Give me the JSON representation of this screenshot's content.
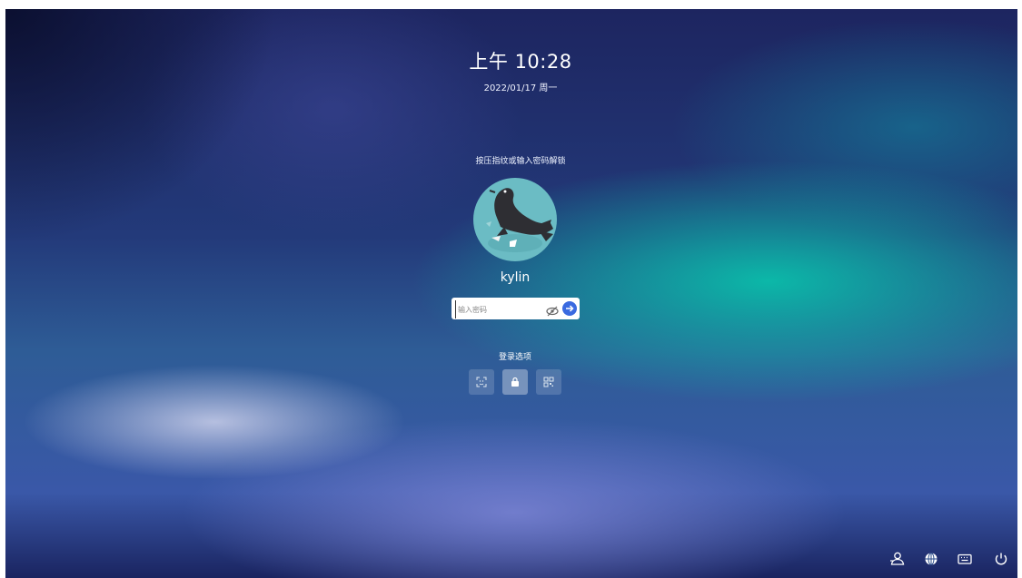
{
  "clock": {
    "time": "上午 10:28",
    "date": "2022/01/17 周一"
  },
  "prompt": "按压指纹或输入密码解锁",
  "user": {
    "name": "kylin"
  },
  "password": {
    "placeholder": "输入密码",
    "value": ""
  },
  "login_options": {
    "title": "登录选项",
    "items": [
      {
        "icon": "face-scan-icon",
        "active": false
      },
      {
        "icon": "password-icon",
        "active": true
      },
      {
        "icon": "qr-code-icon",
        "active": false
      }
    ]
  },
  "tray": [
    "switch-user-icon",
    "network-icon",
    "keyboard-icon",
    "power-icon"
  ],
  "colors": {
    "accent": "#3a6ae0",
    "avatar_bg": "#6bbcc4"
  }
}
